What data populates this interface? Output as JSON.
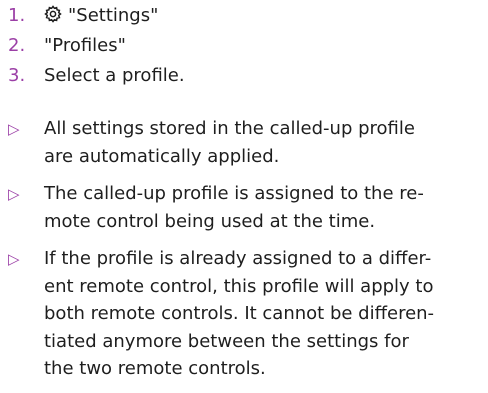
{
  "steps": [
    {
      "number": "1.",
      "icon": "settings-gear-icon",
      "text": "\"Settings\""
    },
    {
      "number": "2.",
      "text": "\"Profiles\""
    },
    {
      "number": "3.",
      "text": "Select a profile."
    }
  ],
  "results": [
    {
      "marker": "▷",
      "lines": [
        "All settings stored in the called-up profile",
        "are automatically applied."
      ]
    },
    {
      "marker": "▷",
      "lines": [
        "The called-up profile is assigned to the re-",
        "mote control being used at the time."
      ]
    },
    {
      "marker": "▷",
      "lines": [
        "If the profile is already assigned to a differ-",
        "ent remote control, this profile will apply to",
        "both remote controls. It cannot be differen-",
        "tiated anymore between the settings for",
        "the two remote controls."
      ]
    }
  ],
  "colors": {
    "accent": "#9b3fa6",
    "text": "#1e1e1e"
  }
}
